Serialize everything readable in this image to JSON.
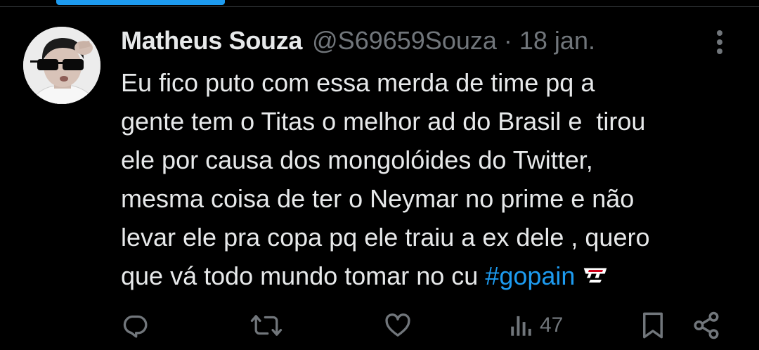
{
  "tweet": {
    "display_name": "Matheus Souza",
    "handle": "@S69659Souza",
    "separator": "·",
    "date": "18 jan.",
    "text_lines": [
      "Eu fico puto com essa merda de time pq a",
      "gente tem o Titas o melhor ad do Brasil e  tirou",
      "ele por causa dos mongolóides do Twitter,",
      "mesma coisa de ter o Neymar no prime e não",
      "levar ele pra copa pq ele traiu a ex dele , quero"
    ],
    "last_line_prefix": "que vá todo mundo tomar no cu ",
    "hashtag": "#gopain",
    "hashtag_emoji": "pain-gaming-logo"
  },
  "actions": {
    "reply_icon": "reply-icon",
    "retweet_icon": "retweet-icon",
    "like_icon": "heart-icon",
    "views_icon": "views-chart-icon",
    "views_count": "47",
    "bookmark_icon": "bookmark-icon",
    "share_icon": "share-icon"
  },
  "colors": {
    "background": "#000000",
    "text_primary": "#e7e9ea",
    "text_secondary": "#71767b",
    "accent": "#1d9bf0"
  }
}
